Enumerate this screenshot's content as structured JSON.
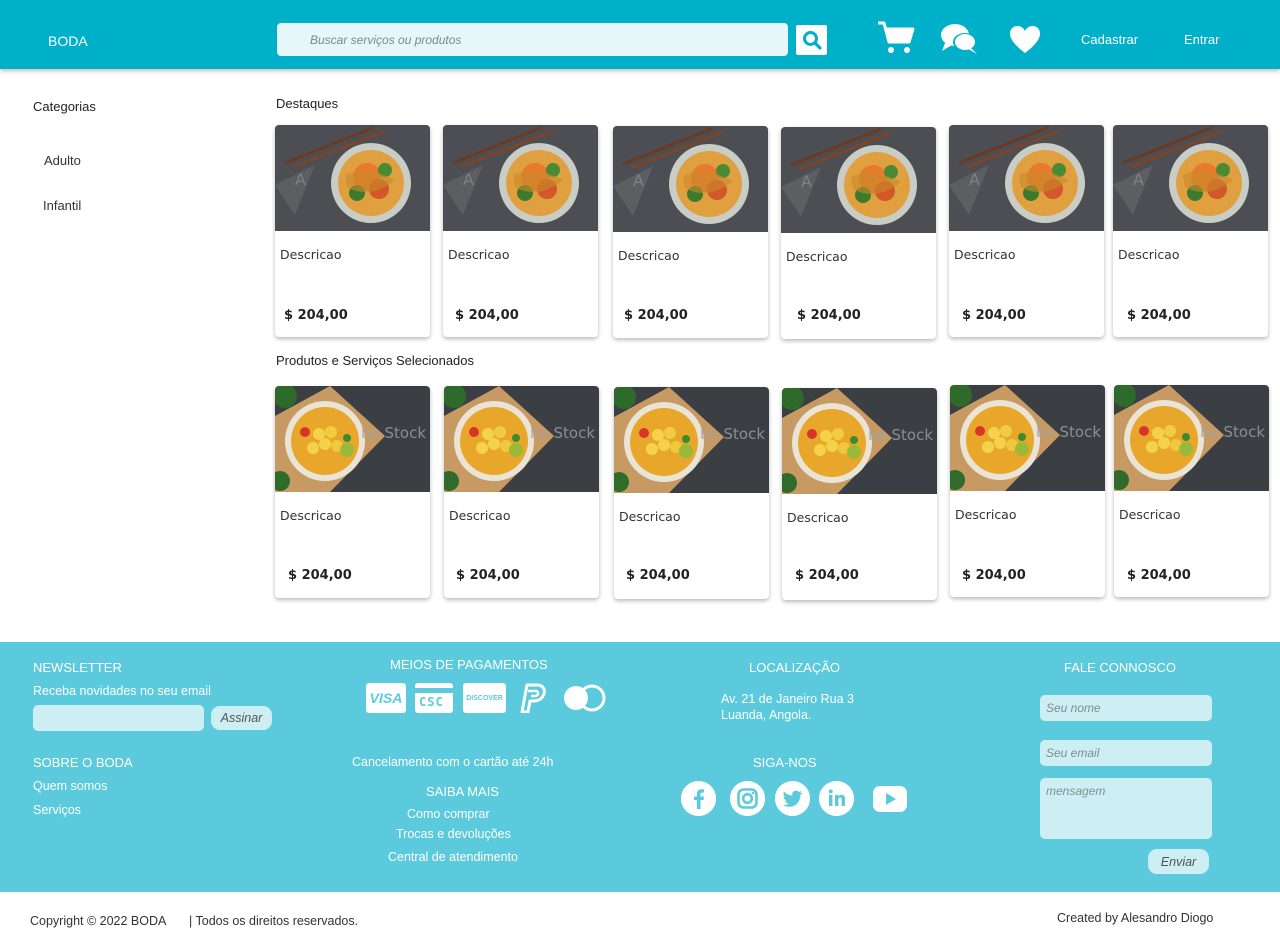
{
  "header": {
    "brand": "BODA",
    "search_placeholder": "Buscar serviços ou produtos",
    "signup_label": "Cadastrar",
    "login_label": "Entrar"
  },
  "sidebar": {
    "title": "Categorias",
    "items": [
      {
        "label": "Adulto"
      },
      {
        "label": "Infantil"
      }
    ]
  },
  "sections": [
    {
      "title": "Destaques",
      "image": "noodle-bowl",
      "cards": [
        {
          "description": "Descricao",
          "price": "$ 204,00"
        },
        {
          "description": "Descricao",
          "price": "$ 204,00"
        },
        {
          "description": "Descricao",
          "price": "$ 204,00"
        },
        {
          "description": "Descricao",
          "price": "$ 204,00"
        },
        {
          "description": "Descricao",
          "price": "$ 204,00"
        },
        {
          "description": "Descricao",
          "price": "$ 204,00"
        }
      ]
    },
    {
      "title": "Produtos e Serviços  Selecionados",
      "image": "curry-bowl",
      "watermark": "Stock",
      "cards": [
        {
          "description": "Descricao",
          "price": "$ 204,00"
        },
        {
          "description": "Descricao",
          "price": "$ 204,00"
        },
        {
          "description": "Descricao",
          "price": "$ 204,00"
        },
        {
          "description": "Descricao",
          "price": "$ 204,00"
        },
        {
          "description": "Descricao",
          "price": "$ 204,00"
        },
        {
          "description": "Descricao",
          "price": "$ 204,00"
        }
      ]
    }
  ],
  "footer": {
    "newsletter": {
      "title": "NEWSLETTER",
      "text": "Receba novidades no seu email",
      "button": "Assinar"
    },
    "about": {
      "title": "SOBRE O BODA",
      "links": [
        "Quem somos",
        "Serviços"
      ]
    },
    "payments": {
      "title": "MEIOS DE PAGAMENTOS",
      "methods": [
        {
          "icon": "visa-icon",
          "label": "VISA"
        },
        {
          "icon": "csc-icon",
          "label": "CSC"
        },
        {
          "icon": "discover-icon",
          "label": "DISCOVER"
        },
        {
          "icon": "paypal-icon",
          "label": ""
        },
        {
          "icon": "mastercard-icon",
          "label": ""
        }
      ],
      "note": "Cancelamento com o cartão até 24h"
    },
    "more": {
      "title": "SAIBA MAIS",
      "links": [
        "Como comprar",
        "Trocas e devoluções",
        "Central de atendimento"
      ]
    },
    "location": {
      "title": "LOCALIZAÇÃO",
      "line1": "Av. 21 de Janeiro Rua 3",
      "line2": "Luanda, Angola."
    },
    "follow": {
      "title": "SIGA-NOS",
      "networks": [
        "facebook-icon",
        "instagram-icon",
        "twitter-icon",
        "linkedin-icon",
        "youtube-icon"
      ]
    },
    "contact": {
      "title": "FALE CONNOSCO",
      "name_placeholder": "Seu nome",
      "email_placeholder": "Seu email",
      "message_placeholder": "mensagem",
      "button": "Enviar"
    }
  },
  "bottom": {
    "copyright": "Copyright © 2022 BODA",
    "rights": "| Todos os direitos reservados.",
    "credit": "Created by Alesandro Diogo"
  },
  "colors": {
    "header": "#00b0c8",
    "footer": "#5bcadd",
    "field": "#cdeef2"
  }
}
